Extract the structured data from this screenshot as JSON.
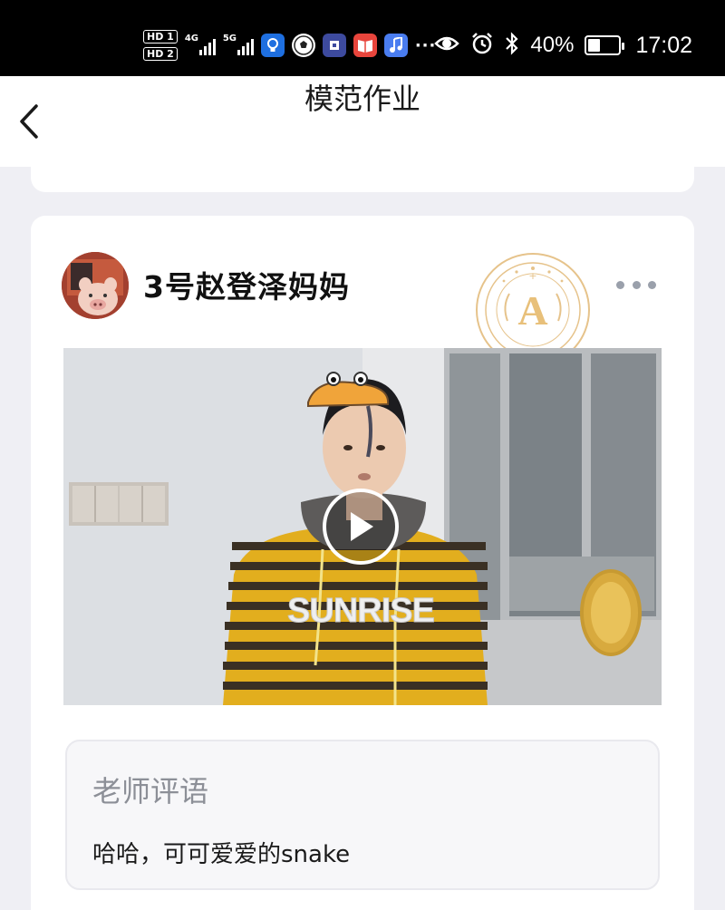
{
  "status_bar": {
    "hd1": "HD 1",
    "hd2": "HD 2",
    "net1": "4G",
    "net2": "5G",
    "app_icons": [
      "lightbulb-app-icon",
      "soccer-app-icon",
      "chip-app-icon",
      "book-app-icon",
      "music-app-icon"
    ],
    "more": "···",
    "battery_percent": "40%",
    "battery_level": 0.4,
    "time": "17:02"
  },
  "nav": {
    "back_icon": "chevron-left-icon",
    "title": "模范作业"
  },
  "post": {
    "user_name": "3号赵登泽妈妈",
    "more_icon": "ellipsis-icon",
    "grade_badge": "A",
    "video": {
      "shirt_text": "SUNRISE",
      "play_icon": "play-icon"
    },
    "teacher_comment": {
      "label": "老师评语",
      "text": "哈哈，可可爱爱的snake"
    }
  },
  "colors": {
    "background": "#efeff4",
    "card": "#ffffff",
    "badge_gold": "#d9a85c",
    "comment_label": "#8c8f97"
  }
}
